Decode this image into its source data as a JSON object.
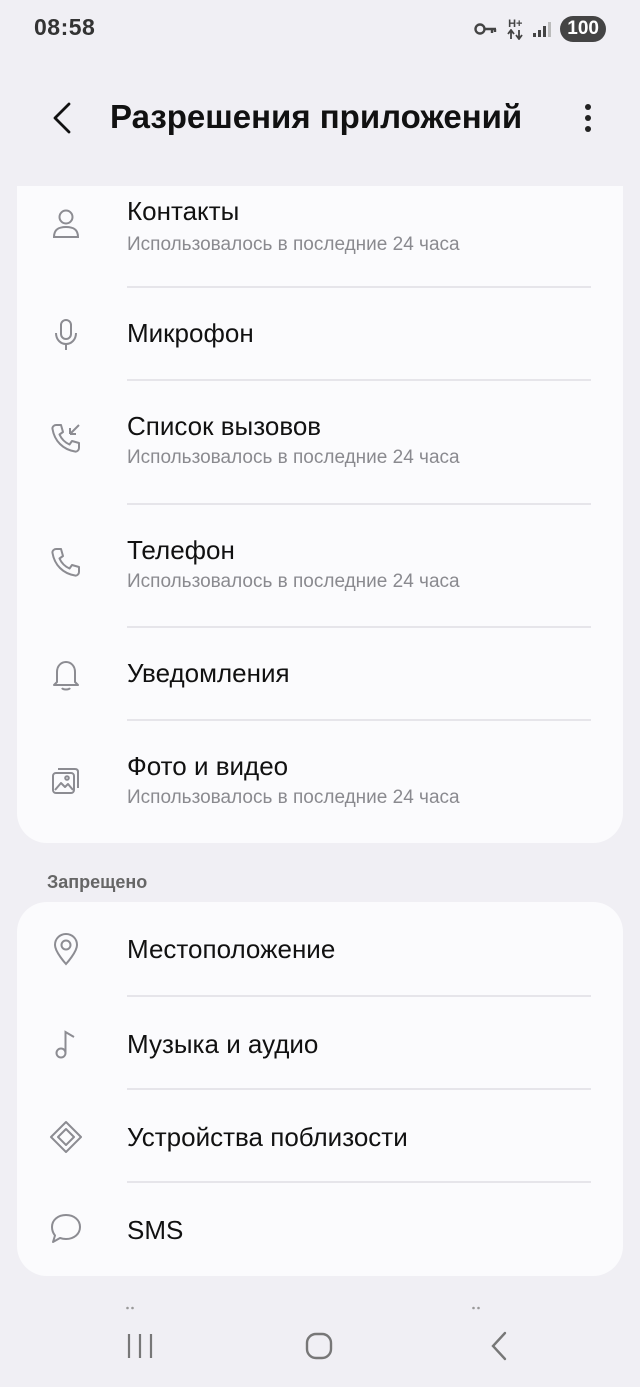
{
  "status_bar": {
    "time": "08:58",
    "network_top": "H+",
    "battery": "100"
  },
  "header": {
    "title": "Разрешения приложений"
  },
  "allowed_items": [
    {
      "icon": "person-icon",
      "title": "Контакты",
      "subtitle": "Использовалось в последние 24 часа"
    },
    {
      "icon": "microphone-icon",
      "title": "Микрофон",
      "subtitle": ""
    },
    {
      "icon": "call-log-icon",
      "title": "Список вызовов",
      "subtitle": "Использовалось в последние 24 часа"
    },
    {
      "icon": "phone-icon",
      "title": "Телефон",
      "subtitle": "Использовалось в последние 24 часа"
    },
    {
      "icon": "bell-icon",
      "title": "Уведомления",
      "subtitle": ""
    },
    {
      "icon": "photos-icon",
      "title": "Фото и видео",
      "subtitle": "Использовалось в последние 24 часа"
    }
  ],
  "denied_section": {
    "label": "Запрещено",
    "items": [
      {
        "icon": "location-pin-icon",
        "title": "Местоположение"
      },
      {
        "icon": "music-note-icon",
        "title": "Музыка и аудио"
      },
      {
        "icon": "nearby-devices-icon",
        "title": "Устройства поблизости"
      },
      {
        "icon": "message-bubble-icon",
        "title": "SMS"
      }
    ]
  },
  "nav_bar": {
    "buttons": [
      "recent-apps",
      "home",
      "back"
    ]
  },
  "colors": {
    "background": "#f0eff4",
    "card": "#fbfbfd",
    "subtitle": "#8a8a8f",
    "icon": "#8c8c92"
  }
}
